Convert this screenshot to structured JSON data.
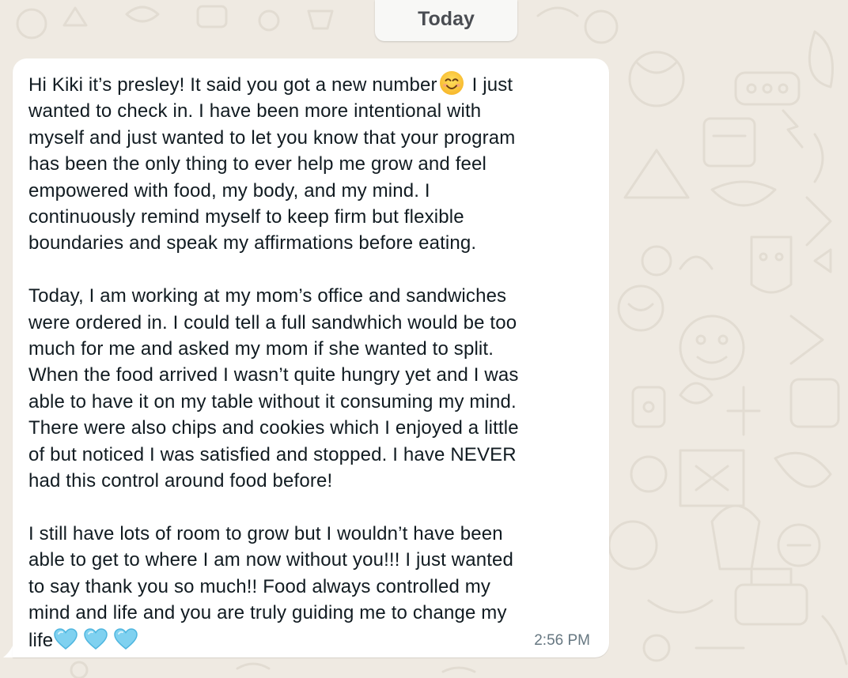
{
  "date_separator": {
    "label": "Today"
  },
  "message": {
    "lines_p1": [
      "Hi Kiki it’s presley! It said you got a new number",
      "I just",
      "wanted to check in. I have been more intentional with",
      "myself and just wanted to let you know that your program",
      "has been the only thing to ever help me grow and feel",
      "empowered with food, my body, and my mind. I",
      "continuously remind myself to keep firm but flexible",
      "boundaries and speak my affirmations before eating."
    ],
    "lines_p2": [
      "Today, I am working at my mom’s office and sandwiches",
      "were ordered in. I could tell a full sandwhich would be too",
      "much for me and asked my mom if she wanted to split.",
      "When the food arrived I wasn’t quite hungry yet and I was",
      "able to have it on my table without it consuming my mind.",
      "There were also chips and cookies which I enjoyed a little",
      "of but noticed I was satisfied and stopped. I have NEVER",
      "had this control around food before!"
    ],
    "lines_p3": [
      "I still have lots of room to grow but I wouldn’t have been",
      "able to get to where I am now without you!!! I just wanted",
      "to say thank you so much!! Food always controlled my",
      "mind and life and you are truly guiding me to change my",
      "life"
    ],
    "emoji_after_number": "smiling-face-icon",
    "trailing_emoji": [
      "light-blue-heart-icon",
      "light-blue-heart-icon",
      "light-blue-heart-icon"
    ],
    "timestamp": "2:56 PM"
  },
  "colors": {
    "wallpaper": "#efeae2",
    "bubble": "#ffffff",
    "text": "#111b21",
    "timestamp": "#667781",
    "heart": "#7fd1f0"
  }
}
